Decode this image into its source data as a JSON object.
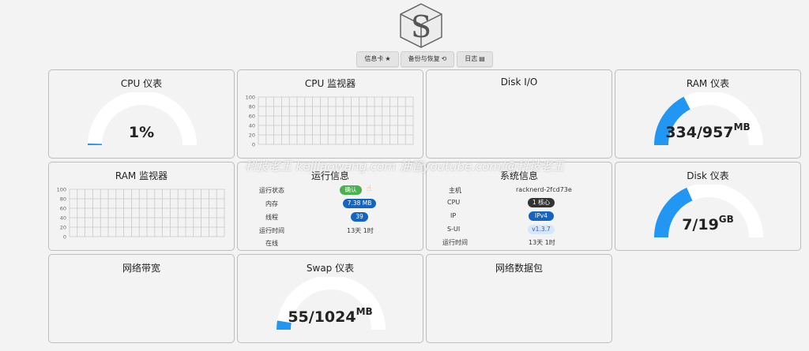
{
  "toolbar": {
    "info_card": "信息卡",
    "backup": "备份与恢复",
    "logs": "日志"
  },
  "cards": {
    "cpu_gauge": {
      "title": "CPU 仪表",
      "value": "1%",
      "fraction": 0.01
    },
    "cpu_monitor": {
      "title": "CPU 监视器",
      "ticks": [
        "100",
        "80",
        "60",
        "40",
        "20",
        "0"
      ]
    },
    "disk_io": {
      "title": "Disk I/O"
    },
    "ram_gauge": {
      "title": "RAM 仪表",
      "value": "334/957",
      "unit": "MB",
      "fraction": 0.349
    },
    "ram_monitor": {
      "title": "RAM 监视器",
      "ticks": [
        "100",
        "80",
        "60",
        "40",
        "20",
        "0"
      ]
    },
    "run_info": {
      "title": "运行信息",
      "rows": [
        {
          "label": "运行状态",
          "value": "确认"
        },
        {
          "label": "内存",
          "value": "7.38 MB"
        },
        {
          "label": "线程",
          "value": "39"
        },
        {
          "label": "运行时间",
          "value": "13天 1时"
        },
        {
          "label": "在线",
          "value": ""
        }
      ]
    },
    "sys_info": {
      "title": "系统信息",
      "rows": [
        {
          "label": "主机",
          "value": "racknerd-2fcd73e"
        },
        {
          "label": "CPU",
          "value": "1 核心"
        },
        {
          "label": "IP",
          "value": "IPv4"
        },
        {
          "label": "S-UI",
          "value": "v1.3.7"
        },
        {
          "label": "运行时间",
          "value": "13天 1时"
        }
      ]
    },
    "disk_gauge": {
      "title": "Disk 仪表",
      "value": "7/19",
      "unit": "GB",
      "fraction": 0.368
    },
    "net_bandwidth": {
      "title": "网络带宽"
    },
    "swap_gauge": {
      "title": "Swap 仪表",
      "value": "55/1024",
      "unit": "MB",
      "fraction": 0.054
    },
    "net_packets": {
      "title": "网络数据包"
    }
  },
  "watermark": "科技老王 kejilaowang.com 油管youtube.com/@科技老王",
  "colors": {
    "gauge_fill": "#2196f3",
    "gauge_track": "#ffffff",
    "ok_green": "#4caf50",
    "pill_blue": "#1565c0",
    "pill_dark": "#333333",
    "pill_light": "#d6e6fb"
  }
}
